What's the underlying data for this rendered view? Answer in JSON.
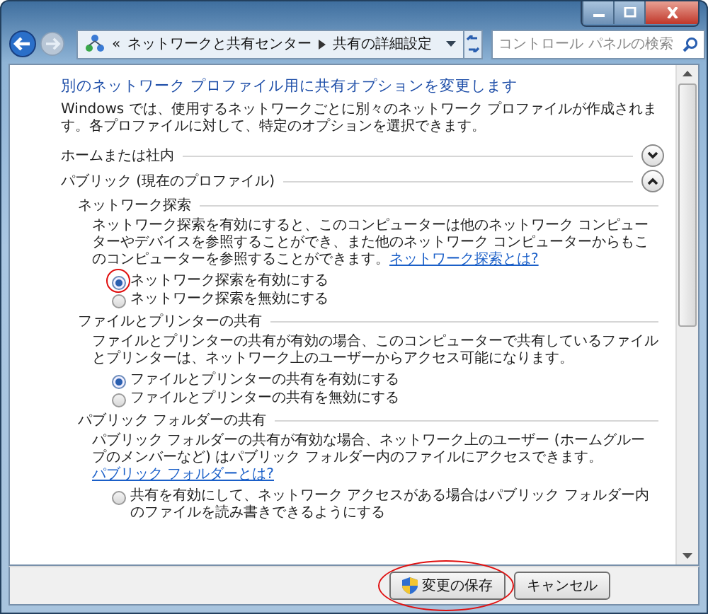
{
  "address_bar": {
    "overflow": "«",
    "crumbs": [
      "ネットワークと共有センター",
      "共有の詳細設定"
    ]
  },
  "search": {
    "placeholder": "コントロール パネルの検索"
  },
  "heading": "別のネットワーク プロファイル用に共有オプションを変更します",
  "description": "Windows では、使用するネットワークごとに別々のネットワーク プロファイルが作成されます。各プロファイルに対して、特定のオプションを選択できます。",
  "profiles": [
    {
      "name": "ホームまたは社内",
      "expanded": false
    },
    {
      "name": "パブリック (現在のプロファイル)",
      "expanded": true,
      "sections": [
        {
          "title": "ネットワーク探索",
          "text": "ネットワーク探索を有効にすると、このコンピューターは他のネットワーク コンピューターやデバイスを参照することができ、また他のネットワーク コンピューターからもこのコンピューターを参照することができます。",
          "link": "ネットワーク探索とは?",
          "options": [
            {
              "label": "ネットワーク探索を有効にする",
              "selected": true,
              "highlighted": true
            },
            {
              "label": "ネットワーク探索を無効にする",
              "selected": false,
              "highlighted": false
            }
          ]
        },
        {
          "title": "ファイルとプリンターの共有",
          "text": "ファイルとプリンターの共有が有効の場合、このコンピューターで共有しているファイルとプリンターは、ネットワーク上のユーザーからアクセス可能になります。",
          "options": [
            {
              "label": "ファイルとプリンターの共有を有効にする",
              "selected": true,
              "highlighted": false
            },
            {
              "label": "ファイルとプリンターの共有を無効にする",
              "selected": false,
              "highlighted": false
            }
          ]
        },
        {
          "title": "パブリック フォルダーの共有",
          "text": "パブリック フォルダーの共有が有効な場合、ネットワーク上のユーザー (ホームグループのメンバーなど) はパブリック フォルダー内のファイルにアクセスできます。",
          "link": "パブリック フォルダーとは?",
          "options": [
            {
              "label": "共有を有効にして、ネットワーク アクセスがある場合はパブリック フォルダー内のファイルを読み書きできるようにする",
              "selected": false,
              "highlighted": false
            }
          ]
        }
      ]
    }
  ],
  "buttons": [
    {
      "label": "変更の保存",
      "kind": "shield",
      "highlighted": true
    },
    {
      "label": "キャンセル",
      "kind": "plain",
      "highlighted": false
    }
  ]
}
